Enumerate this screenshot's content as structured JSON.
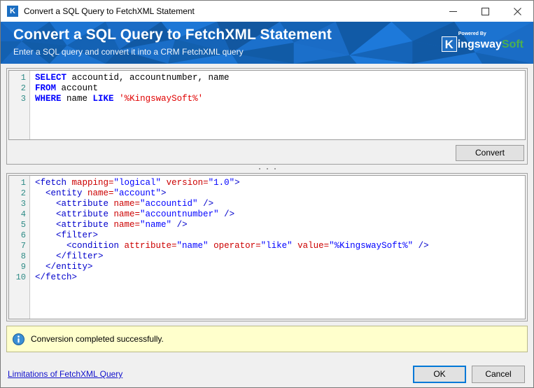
{
  "window": {
    "title": "Convert a SQL Query to FetchXML Statement",
    "app_icon": "kingswaysoft-k-icon",
    "controls": {
      "minimize": "minimize-icon",
      "maximize": "maximize-icon",
      "close": "close-icon"
    }
  },
  "banner": {
    "title": "Convert a SQL Query to FetchXML Statement",
    "subtitle": "Enter a SQL query and convert it into a CRM FetchXML query",
    "logo": {
      "badge": "K",
      "powered_by": "Powered By",
      "name_first": "ingsway",
      "name_second": "Soft",
      "accent_color": "#4caf50",
      "badge_color": "#1f6fc4"
    },
    "background_color": "#1666c0"
  },
  "sql_editor": {
    "line_numbers": [
      "1",
      "2",
      "3"
    ],
    "lines": [
      {
        "tokens": [
          {
            "t": "SELECT",
            "c": "kw"
          },
          {
            "t": " accountid, accountnumber, name",
            "c": ""
          }
        ]
      },
      {
        "tokens": [
          {
            "t": "FROM",
            "c": "kw"
          },
          {
            "t": " account",
            "c": ""
          }
        ]
      },
      {
        "tokens": [
          {
            "t": "WHERE",
            "c": "kw"
          },
          {
            "t": " name ",
            "c": ""
          },
          {
            "t": "LIKE",
            "c": "kw"
          },
          {
            "t": " ",
            "c": ""
          },
          {
            "t": "'%KingswaySoft%'",
            "c": "str"
          }
        ]
      }
    ],
    "plain_text": "SELECT accountid, accountnumber, name\nFROM account\nWHERE name LIKE '%KingswaySoft%'"
  },
  "convert_button": {
    "label": "Convert"
  },
  "xml_editor": {
    "line_numbers": [
      "1",
      "2",
      "3",
      "4",
      "5",
      "6",
      "7",
      "8",
      "9",
      "10"
    ],
    "lines": [
      {
        "tokens": [
          {
            "t": "<fetch ",
            "c": "tag"
          },
          {
            "t": "mapping=",
            "c": "attr"
          },
          {
            "t": "\"logical\"",
            "c": "val"
          },
          {
            "t": " ",
            "c": ""
          },
          {
            "t": "version=",
            "c": "attr"
          },
          {
            "t": "\"1.0\"",
            "c": "val"
          },
          {
            "t": ">",
            "c": "tag"
          }
        ]
      },
      {
        "tokens": [
          {
            "t": "  <entity ",
            "c": "tag"
          },
          {
            "t": "name=",
            "c": "attr"
          },
          {
            "t": "\"account\"",
            "c": "val"
          },
          {
            "t": ">",
            "c": "tag"
          }
        ]
      },
      {
        "tokens": [
          {
            "t": "    <attribute ",
            "c": "tag"
          },
          {
            "t": "name=",
            "c": "attr"
          },
          {
            "t": "\"accountid\"",
            "c": "val"
          },
          {
            "t": " />",
            "c": "tag"
          }
        ]
      },
      {
        "tokens": [
          {
            "t": "    <attribute ",
            "c": "tag"
          },
          {
            "t": "name=",
            "c": "attr"
          },
          {
            "t": "\"accountnumber\"",
            "c": "val"
          },
          {
            "t": " />",
            "c": "tag"
          }
        ]
      },
      {
        "tokens": [
          {
            "t": "    <attribute ",
            "c": "tag"
          },
          {
            "t": "name=",
            "c": "attr"
          },
          {
            "t": "\"name\"",
            "c": "val"
          },
          {
            "t": " />",
            "c": "tag"
          }
        ]
      },
      {
        "tokens": [
          {
            "t": "    <filter>",
            "c": "tag"
          }
        ]
      },
      {
        "tokens": [
          {
            "t": "      <condition ",
            "c": "tag"
          },
          {
            "t": "attribute=",
            "c": "attr"
          },
          {
            "t": "\"name\"",
            "c": "val"
          },
          {
            "t": " ",
            "c": ""
          },
          {
            "t": "operator=",
            "c": "attr"
          },
          {
            "t": "\"like\"",
            "c": "val"
          },
          {
            "t": " ",
            "c": ""
          },
          {
            "t": "value=",
            "c": "attr"
          },
          {
            "t": "\"%KingswaySoft%\"",
            "c": "val"
          },
          {
            "t": " />",
            "c": "tag"
          }
        ]
      },
      {
        "tokens": [
          {
            "t": "    </filter>",
            "c": "tag"
          }
        ]
      },
      {
        "tokens": [
          {
            "t": "  </entity>",
            "c": "tag"
          }
        ]
      },
      {
        "tokens": [
          {
            "t": "</fetch>",
            "c": "tag"
          }
        ]
      }
    ],
    "plain_text": "<fetch mapping=\"logical\" version=\"1.0\">\n  <entity name=\"account\">\n    <attribute name=\"accountid\" />\n    <attribute name=\"accountnumber\" />\n    <attribute name=\"name\" />\n    <filter>\n      <condition attribute=\"name\" operator=\"like\" value=\"%KingswaySoft%\" />\n    </filter>\n  </entity>\n</fetch>"
  },
  "status": {
    "icon": "info-icon",
    "message": "Conversion completed successfully.",
    "background_color": "#ffffcc"
  },
  "footer": {
    "link_label": "Limitations of FetchXML Query",
    "ok_label": "OK",
    "cancel_label": "Cancel",
    "default_button_color": "#0078d7"
  }
}
